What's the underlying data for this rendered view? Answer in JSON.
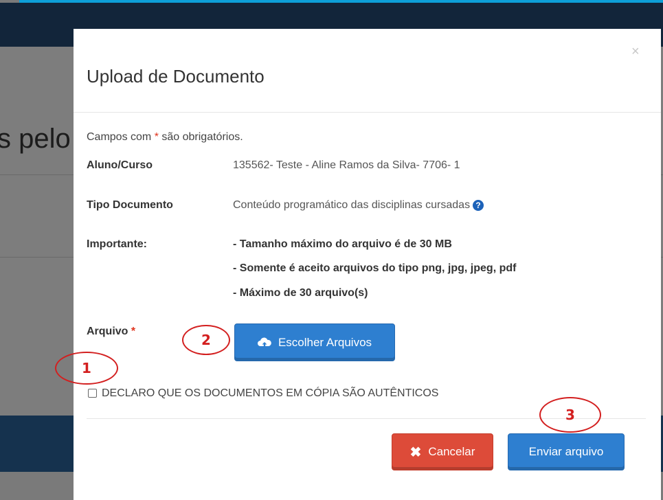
{
  "background": {
    "heading_fragment": "s pelo"
  },
  "modal": {
    "title": "Upload de Documento",
    "close_symbol": "×",
    "required_note_prefix": "Campos com ",
    "required_star": "*",
    "required_note_suffix": " são obrigatórios.",
    "rows": {
      "aluno_label": "Aluno/Curso",
      "aluno_value": "135562- Teste - Aline Ramos da Silva- 7706- 1",
      "tipo_label": "Tipo Documento",
      "tipo_value": "Conteúdo programático das disciplinas cursadas",
      "importante_label": "Importante:",
      "importante_lines": [
        "- Tamanho máximo do arquivo é de 30 MB",
        "- Somente é aceito arquivos do tipo png, jpg, jpeg, pdf",
        "- Máximo de 30 arquivo(s)"
      ],
      "arquivo_label": "Arquivo"
    },
    "help_icon": "?",
    "choose_files_label": "Escolher Arquivos",
    "declaration_label": "DECLARO QUE OS DOCUMENTOS EM CÓPIA SÃO AUTÊNTICOS",
    "cancel_label": "Cancelar",
    "cancel_icon": "✖",
    "send_label": "Enviar arquivo"
  },
  "annotations": [
    "1",
    "2",
    "3"
  ],
  "colors": {
    "primary": "#2e7fd0",
    "danger": "#dd4b39",
    "required": "#e0341e",
    "annotation": "#d31f1f"
  }
}
